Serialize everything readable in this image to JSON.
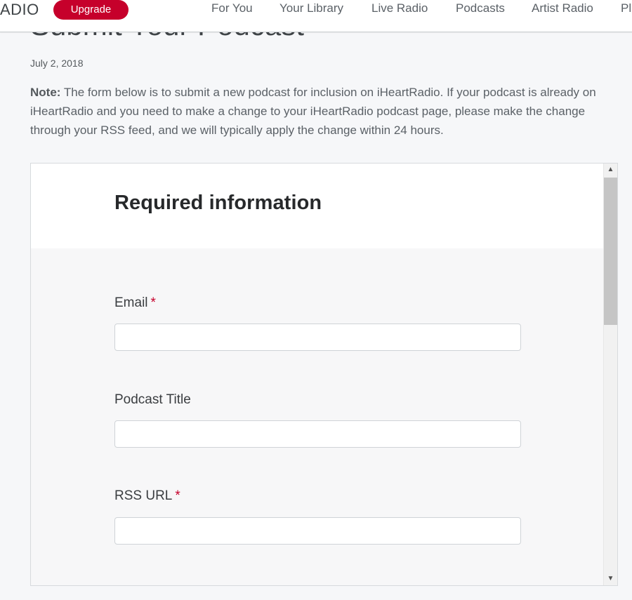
{
  "page": {
    "title": "Submit Your Podcast",
    "date": "July 2, 2018",
    "note_label": "Note:",
    "note_text": " The form below is to submit a new podcast for inclusion on iHeartRadio. If your podcast is already on iHeartRadio and you need to make a change to your iHeartRadio podcast page, please make the change through your RSS feed, and we will typically apply the change within 24 hours."
  },
  "header": {
    "logo_text": "ADIO",
    "upgrade_label": "Upgrade",
    "nav": [
      {
        "label": "For You"
      },
      {
        "label": "Your Library"
      },
      {
        "label": "Live Radio"
      },
      {
        "label": "Podcasts"
      },
      {
        "label": "Artist Radio"
      },
      {
        "label": "Pl"
      }
    ]
  },
  "form": {
    "heading": "Required information",
    "required_marker": "*",
    "fields": [
      {
        "label": "Email",
        "value": "",
        "required": true
      },
      {
        "label": "Podcast Title",
        "value": "",
        "required": false
      },
      {
        "label": "RSS URL",
        "value": "",
        "required": true
      }
    ]
  },
  "scrollbar": {
    "up_icon": "▲",
    "down_icon": "▼",
    "position": 0.0
  },
  "colors": {
    "brand": "#c6002b",
    "background": "#f6f7f9"
  }
}
